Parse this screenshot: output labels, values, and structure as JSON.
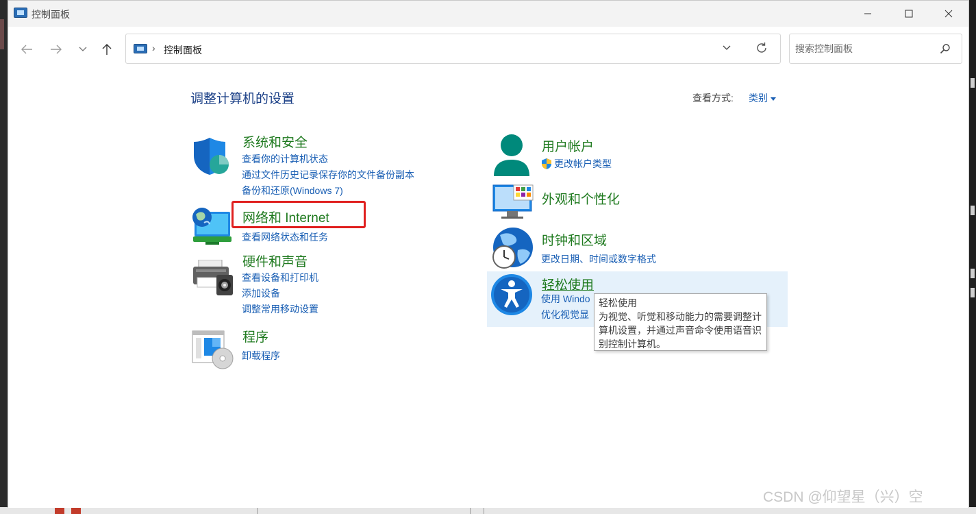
{
  "window": {
    "title": "控制面板"
  },
  "addressbar": {
    "breadcrumb": "控制面板"
  },
  "search": {
    "placeholder": "搜索控制面板"
  },
  "header": {
    "page_title": "调整计算机的设置",
    "view_by_label": "查看方式:",
    "view_by_value": "类别"
  },
  "categories_left": [
    {
      "title": "系统和安全",
      "links": [
        "查看你的计算机状态",
        "通过文件历史记录保存你的文件备份副本",
        "备份和还原(Windows 7)"
      ]
    },
    {
      "title": "网络和 Internet",
      "links": [
        "查看网络状态和任务"
      ]
    },
    {
      "title": "硬件和声音",
      "links": [
        "查看设备和打印机",
        "添加设备",
        "调整常用移动设置"
      ]
    },
    {
      "title": "程序",
      "links": [
        "卸载程序"
      ]
    }
  ],
  "categories_right": [
    {
      "title": "用户帐户",
      "links": [
        "更改帐户类型"
      ]
    },
    {
      "title": "外观和个性化",
      "links": []
    },
    {
      "title": "时钟和区域",
      "links": [
        "更改日期、时间或数字格式"
      ]
    },
    {
      "title": "轻松使用",
      "links": [
        "使用 Windo",
        "优化视觉显"
      ]
    }
  ],
  "tooltip": {
    "title": "轻松使用",
    "description": "为视觉、听觉和移动能力的需要调整计算机设置，并通过声音命令使用语音识别控制计算机。"
  },
  "watermark": "CSDN @仰望星（兴）空",
  "colors": {
    "link": "#1a5fb4",
    "category_title": "#1f7a1f",
    "page_title": "#1a3f86",
    "highlight_box": "#e0201f",
    "hover_bg": "#e5f1fb"
  },
  "icons": [
    "shield-icon",
    "network-icon",
    "printer-icon",
    "programs-icon",
    "user-icon",
    "uac-shield-icon",
    "appearance-icon",
    "clock-globe-icon",
    "accessibility-icon"
  ]
}
